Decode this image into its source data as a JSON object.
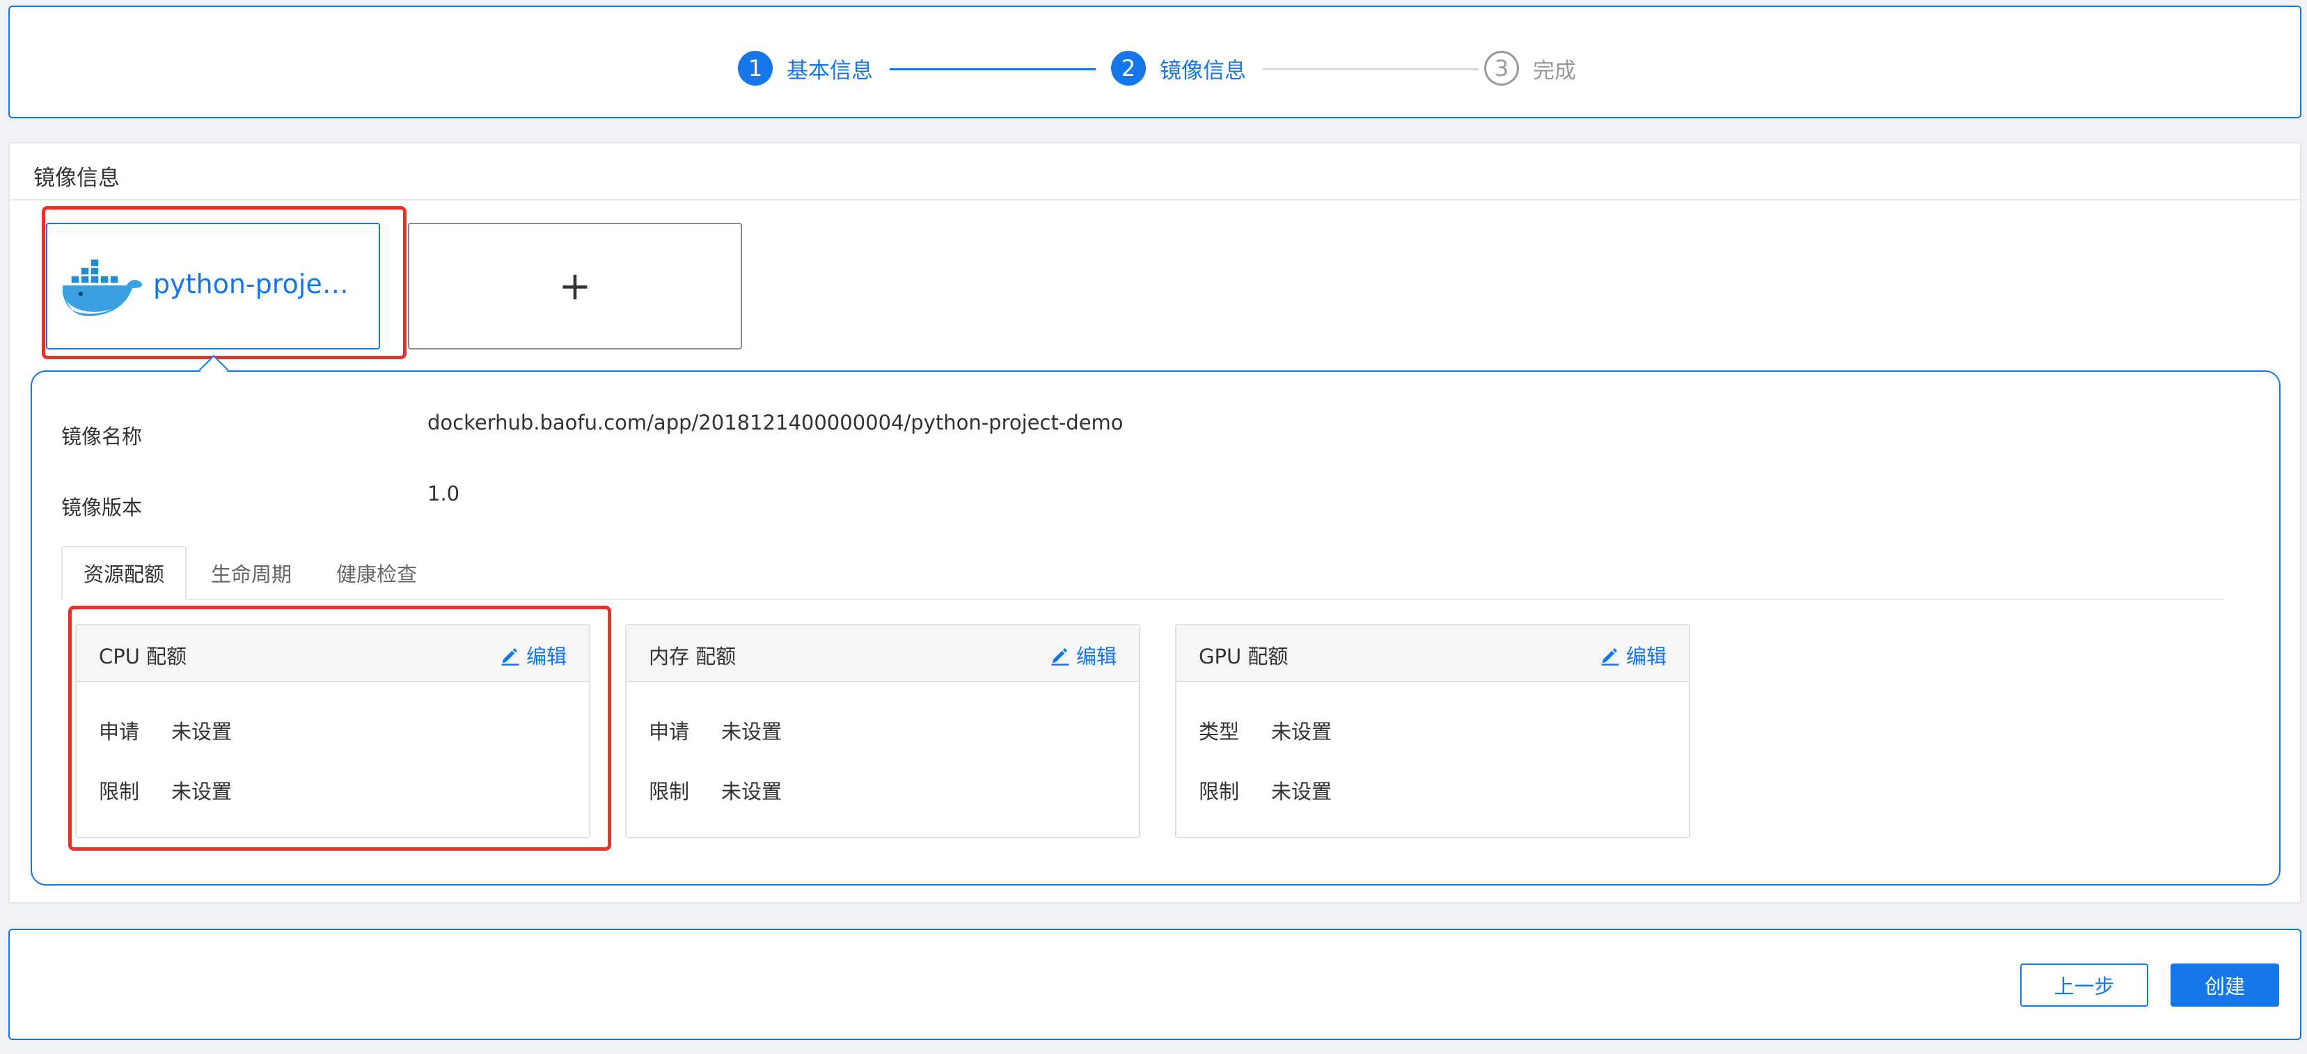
{
  "steps": [
    {
      "number": "1",
      "label": "基本信息"
    },
    {
      "number": "2",
      "label": "镜像信息"
    },
    {
      "number": "3",
      "label": "完成"
    }
  ],
  "section": {
    "title": "镜像信息"
  },
  "image_card": {
    "name": "python-project-demo"
  },
  "add_card": {
    "symbol": "+"
  },
  "details": {
    "image_name_label": "镜像名称",
    "image_name_value": "dockerhub.baofu.com/app/2018121400000004/python-project-demo",
    "image_version_label": "镜像版本",
    "image_version_value": "1.0"
  },
  "tabs": [
    {
      "label": "资源配额"
    },
    {
      "label": "生命周期"
    },
    {
      "label": "健康检查"
    }
  ],
  "quotas": [
    {
      "title": "CPU 配额",
      "edit": "编辑",
      "rows": [
        {
          "key": "申请",
          "value": "未设置"
        },
        {
          "key": "限制",
          "value": "未设置"
        }
      ]
    },
    {
      "title": "内存 配额",
      "edit": "编辑",
      "rows": [
        {
          "key": "申请",
          "value": "未设置"
        },
        {
          "key": "限制",
          "value": "未设置"
        }
      ]
    },
    {
      "title": "GPU 配额",
      "edit": "编辑",
      "rows": [
        {
          "key": "类型",
          "value": "未设置"
        },
        {
          "key": "限制",
          "value": "未设置"
        }
      ]
    }
  ],
  "footer": {
    "prev": "上一步",
    "create": "创建"
  },
  "colors": {
    "accent": "#1476e8",
    "highlight": "#e6332a",
    "pending": "#9a9a9a"
  },
  "icons": {
    "image": "docker-whale-icon",
    "edit": "pencil-icon"
  }
}
